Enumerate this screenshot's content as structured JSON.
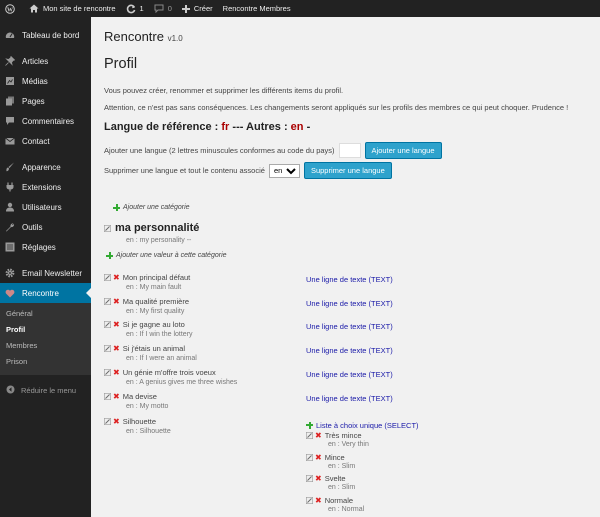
{
  "adminbar": {
    "site_name": "Mon site de rencontre",
    "updates": "1",
    "comments": "0",
    "new_label": "Créer",
    "members_label": "Rencontre Membres"
  },
  "sidebar": {
    "items": [
      {
        "label": "Tableau de bord",
        "icon": "dashboard-icon"
      },
      {
        "label": "Articles",
        "icon": "pin-icon"
      },
      {
        "label": "Médias",
        "icon": "media-icon"
      },
      {
        "label": "Pages",
        "icon": "pages-icon"
      },
      {
        "label": "Commentaires",
        "icon": "comments-icon"
      },
      {
        "label": "Contact",
        "icon": "mail-icon"
      },
      {
        "label": "Apparence",
        "icon": "brush-icon"
      },
      {
        "label": "Extensions",
        "icon": "plugin-icon"
      },
      {
        "label": "Utilisateurs",
        "icon": "users-icon"
      },
      {
        "label": "Outils",
        "icon": "wrench-icon"
      },
      {
        "label": "Réglages",
        "icon": "settings-icon"
      },
      {
        "label": "Email Newsletter",
        "icon": "gear-icon"
      },
      {
        "label": "Rencontre",
        "icon": "heart-icon"
      }
    ],
    "submenu": [
      "Général",
      "Profil",
      "Membres",
      "Prison"
    ],
    "collapse_label": "Réduire le menu"
  },
  "main": {
    "plugin_title": "Rencontre",
    "plugin_version": "v1.0",
    "page_title": "Profil",
    "intro": "Vous pouvez créer, renommer et supprimer les différents items du profil.",
    "warning": "Attention, ce n'est pas sans conséquences. Les changements seront appliqués sur les profils des membres ce qui peut choquer. Prudence !",
    "lang_ref_prefix": "Langue de référence :",
    "lang_ref": "fr",
    "lang_others_prefix": "--- Autres :",
    "lang_others": "en",
    "lang_others_suffix": "-",
    "add_lang_label": "Ajouter une langue (2 lettres minuscules conformes au code du pays)",
    "add_lang_button": "Ajouter une langue",
    "del_lang_label": "Supprimer une langue et tout le contenu associé",
    "del_lang_selected": "en",
    "del_lang_button": "Supprimer une langue",
    "add_category": "Ajouter une catégorie",
    "category_title": "ma personnalité",
    "category_en": "en : my personality --",
    "add_value": "Ajouter une valeur à cette catégorie",
    "items": [
      {
        "label": "Mon principal défaut",
        "en": "en : My main fault",
        "type": "Une ligne de texte (TEXT)"
      },
      {
        "label": "Ma qualité première",
        "en": "en : My first quality",
        "type": "Une ligne de texte (TEXT)"
      },
      {
        "label": "Si je gagne au loto",
        "en": "en : If I win the lottery",
        "type": "Une ligne de texte (TEXT)"
      },
      {
        "label": "Si j'étais un animal",
        "en": "en : If I were an animal",
        "type": "Une ligne de texte (TEXT)"
      },
      {
        "label": "Un génie m'offre trois voeux",
        "en": "en : A genius gives me three wishes",
        "type": "Une ligne de texte (TEXT)"
      },
      {
        "label": "Ma devise",
        "en": "en : My motto",
        "type": "Une ligne de texte (TEXT)"
      },
      {
        "label": "Silhouette",
        "en": "en : Silhouette",
        "type": ""
      }
    ],
    "select_title": "Liste à choix unique (SELECT)",
    "select_options": [
      {
        "label": "Très mince",
        "en": "en : Very thin"
      },
      {
        "label": "Mince",
        "en": "en : Slim"
      },
      {
        "label": "Svelte",
        "en": "en : Slim"
      },
      {
        "label": "Normale",
        "en": "en : Normal"
      }
    ]
  }
}
